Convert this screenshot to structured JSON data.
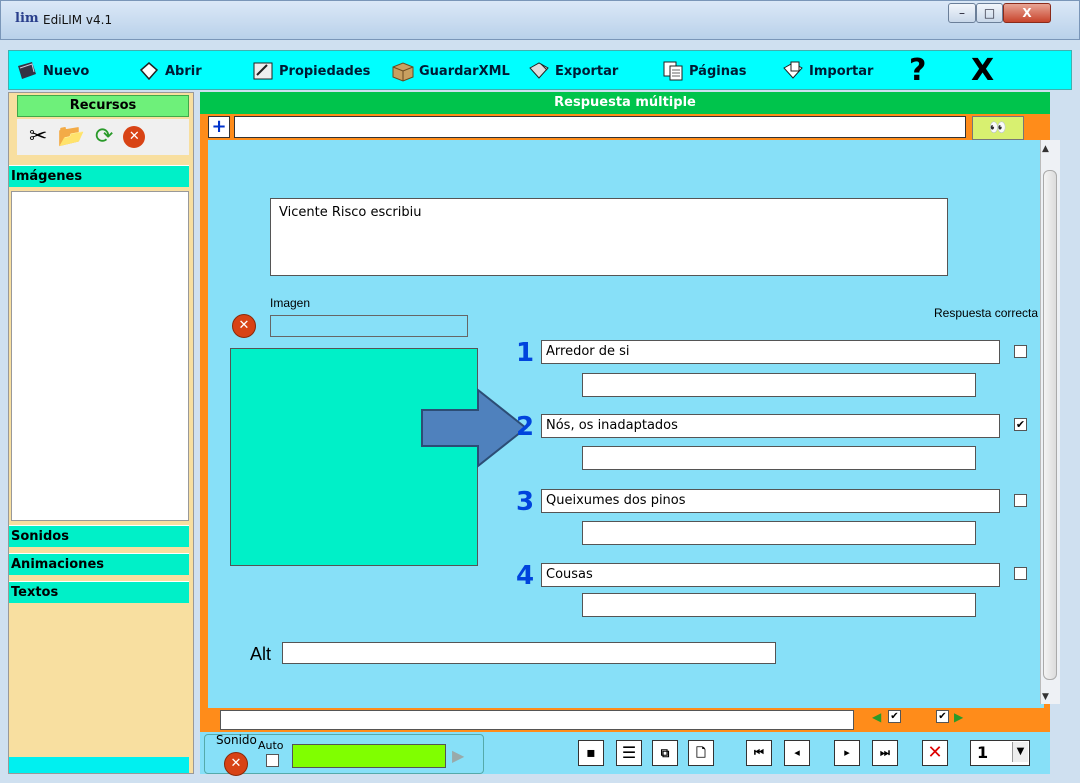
{
  "window": {
    "logo": "lim",
    "title": "EdiLIM  v4.1",
    "min": "–",
    "max": "□",
    "close": "X"
  },
  "toolbar": {
    "nuevo": "Nuevo",
    "abrir": "Abrir",
    "propiedades": "Propiedades",
    "guardar": "GuardarXML",
    "exportar": "Exportar",
    "paginas": "Páginas",
    "importar": "Importar",
    "help": "?",
    "exit": "X"
  },
  "resources": {
    "header": "Recursos",
    "categories": [
      "Imágenes",
      "Sonidos",
      "Animaciones",
      "Textos"
    ]
  },
  "workspace": {
    "title": "Respuesta múltiple",
    "question": "Vicente Risco escribiu",
    "image_label": "Imagen",
    "correct_label": "Respuesta correcta",
    "alt_label": "Alt",
    "answers": [
      {
        "num": "1",
        "text": "Arredor de si",
        "correct": false
      },
      {
        "num": "2",
        "text": "Nós, os inadaptados",
        "correct": true
      },
      {
        "num": "3",
        "text": "Queixumes dos pinos",
        "correct": false
      },
      {
        "num": "4",
        "text": "Cousas",
        "correct": false
      }
    ]
  },
  "bottom": {
    "sonido_label": "Sonido",
    "auto_label": "Auto",
    "page_value": "1"
  },
  "colors": {
    "toolbar": "#00ffff",
    "title_bar": "#00c44c",
    "workspace": "#87e0f8",
    "accent_orange": "#ff8c1a",
    "number_blue": "#0044dd"
  }
}
